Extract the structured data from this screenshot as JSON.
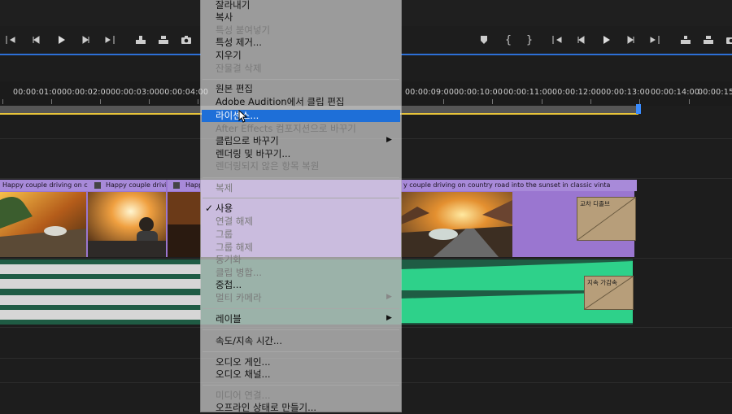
{
  "timecodes": [
    "00:00:01:00",
    "00:00:02:00",
    "00:00:03:00",
    "00:00:04:00",
    "00:00:09:00",
    "00:00:10:00",
    "00:00:11:00",
    "00:00:12:00",
    "00:00:13:00",
    "00:00:14:00",
    "00:00:15:0"
  ],
  "clip": {
    "title_1": "Happy couple driving on count",
    "title_2": "Happy couple driving",
    "title_3": "Happ",
    "title_main": "y couple driving on country road into the sunset in classic vinta"
  },
  "transitions": {
    "video": "교차 디졸브",
    "audio": "지속 가감속"
  },
  "menu": {
    "cut": "잘라내기",
    "copy": "복사",
    "paste_attrs": "특성 붙여넣기",
    "remove_attrs": "특성 제거...",
    "clear": "지우기",
    "ripple_delete": "잔물결 삭제",
    "edit_original": "원본 편집",
    "edit_audition": "Adobe Audition에서 클립 편집",
    "license": "라이센스...",
    "replace_ae": "After Effects 컴포지션으로 바꾸기",
    "replace_clip": "클립으로 바꾸기",
    "render_replace": "렌더링 및 바꾸기...",
    "restore_unrendered": "렌더링되지 않은 항목 복원",
    "duplicate": "복제",
    "enable": "사용",
    "unlink": "연결 해제",
    "group": "그룹",
    "ungroup": "그룹 해제",
    "synchronize": "동기화",
    "merge_clips": "클립 병합...",
    "nest": "중첩...",
    "multicam": "멀티 카메라",
    "label": "레이블",
    "speed_duration": "속도/지속 시간...",
    "audio_gain": "오디오 게인...",
    "audio_channels": "오디오 채널...",
    "link_media": "미디어 연결...",
    "make_offline": "오프라인 상태로 만들기..."
  },
  "colors": {
    "highlight": "#1e6fd8",
    "video_clip": "#9a76d0",
    "audio_clip": "#1f5c44",
    "work_line": "#e8c43a"
  }
}
